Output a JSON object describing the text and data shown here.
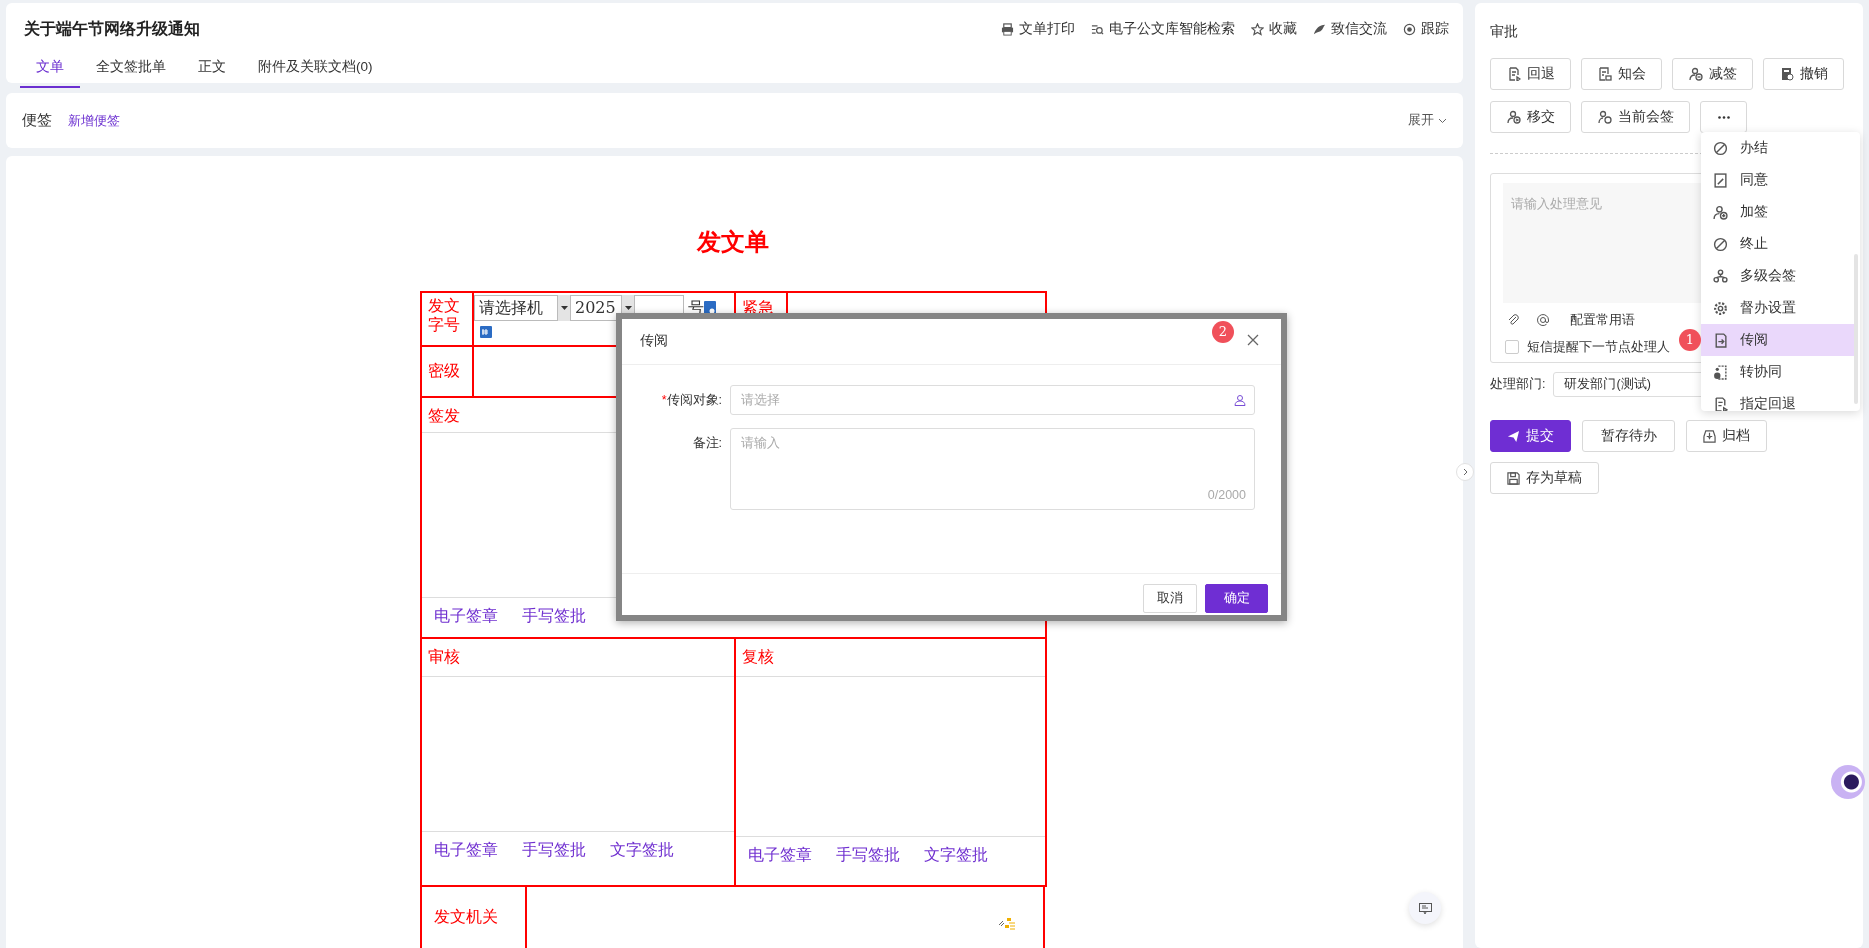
{
  "header": {
    "title": "关于端午节网络升级通知",
    "actions": [
      {
        "label": "文单打印"
      },
      {
        "label": "电子公文库智能检索"
      },
      {
        "label": "收藏"
      },
      {
        "label": "致信交流"
      },
      {
        "label": "跟踪"
      }
    ],
    "tabs": [
      {
        "label": "文单",
        "selected": true
      },
      {
        "label": "全文签批单",
        "selected": false
      },
      {
        "label": "正文",
        "selected": false
      },
      {
        "label": "附件及关联文档(0)",
        "selected": false
      }
    ]
  },
  "notes": {
    "title": "便签",
    "add_link": "新增便签",
    "expand": "展开"
  },
  "form": {
    "title": "发文单",
    "number_row": {
      "label": "发文字号",
      "org_select": "请选择机",
      "year": "2025",
      "suffix": "号",
      "urgency_label": "紧急"
    },
    "secrecy_label": "密级",
    "sections": [
      {
        "label": "签发",
        "actions": [
          "电子签章",
          "手写签批"
        ]
      },
      {
        "label": "审核",
        "actions": [
          "电子签章",
          "手写签批",
          "文字签批"
        ]
      },
      {
        "label": "复核",
        "actions": [
          "电子签章",
          "手写签批",
          "文字签批"
        ]
      }
    ],
    "issuer_label": "发文机关"
  },
  "dialog": {
    "title": "传阅",
    "badge": "2",
    "fields": [
      {
        "kind": "select",
        "required_mark": "*",
        "label": "传阅对象:",
        "placeholder": "请选择"
      },
      {
        "kind": "textarea",
        "label": "备注:",
        "placeholder": "请输入",
        "counter": "0/2000"
      }
    ],
    "buttons": [
      {
        "label": "取消",
        "primary": false
      },
      {
        "label": "确定",
        "primary": true
      }
    ]
  },
  "approval": {
    "title": "审批",
    "actions": [
      {
        "label": "回退"
      },
      {
        "label": "知会"
      },
      {
        "label": "减签"
      },
      {
        "label": "撤销"
      },
      {
        "label": "移交"
      },
      {
        "label": "当前会签"
      },
      {
        "kind": "more"
      }
    ],
    "opinion": {
      "placeholder": "请输入处理意见",
      "phrases": "配置常用语",
      "sms": {
        "label": "短信提醒下一节点处理人",
        "checked": false
      }
    },
    "department": {
      "label": "处理部门:",
      "value": "研发部门(测试)"
    },
    "submit_buttons": [
      {
        "label": "提交",
        "primary": true
      },
      {
        "label": "暂存待办",
        "primary": false
      },
      {
        "label": "归档",
        "primary": false
      },
      {
        "label": "存为草稿",
        "primary": false
      }
    ],
    "menu": {
      "badge": "1",
      "items": [
        {
          "label": "办结",
          "selected": false
        },
        {
          "label": "同意",
          "selected": false
        },
        {
          "label": "加签",
          "selected": false
        },
        {
          "label": "终止",
          "selected": false
        },
        {
          "label": "多级会签",
          "selected": false
        },
        {
          "label": "督办设置",
          "selected": false
        },
        {
          "label": "传阅",
          "selected": true
        },
        {
          "label": "转协同",
          "selected": false
        },
        {
          "label": "指定回退",
          "selected": false
        }
      ]
    }
  }
}
